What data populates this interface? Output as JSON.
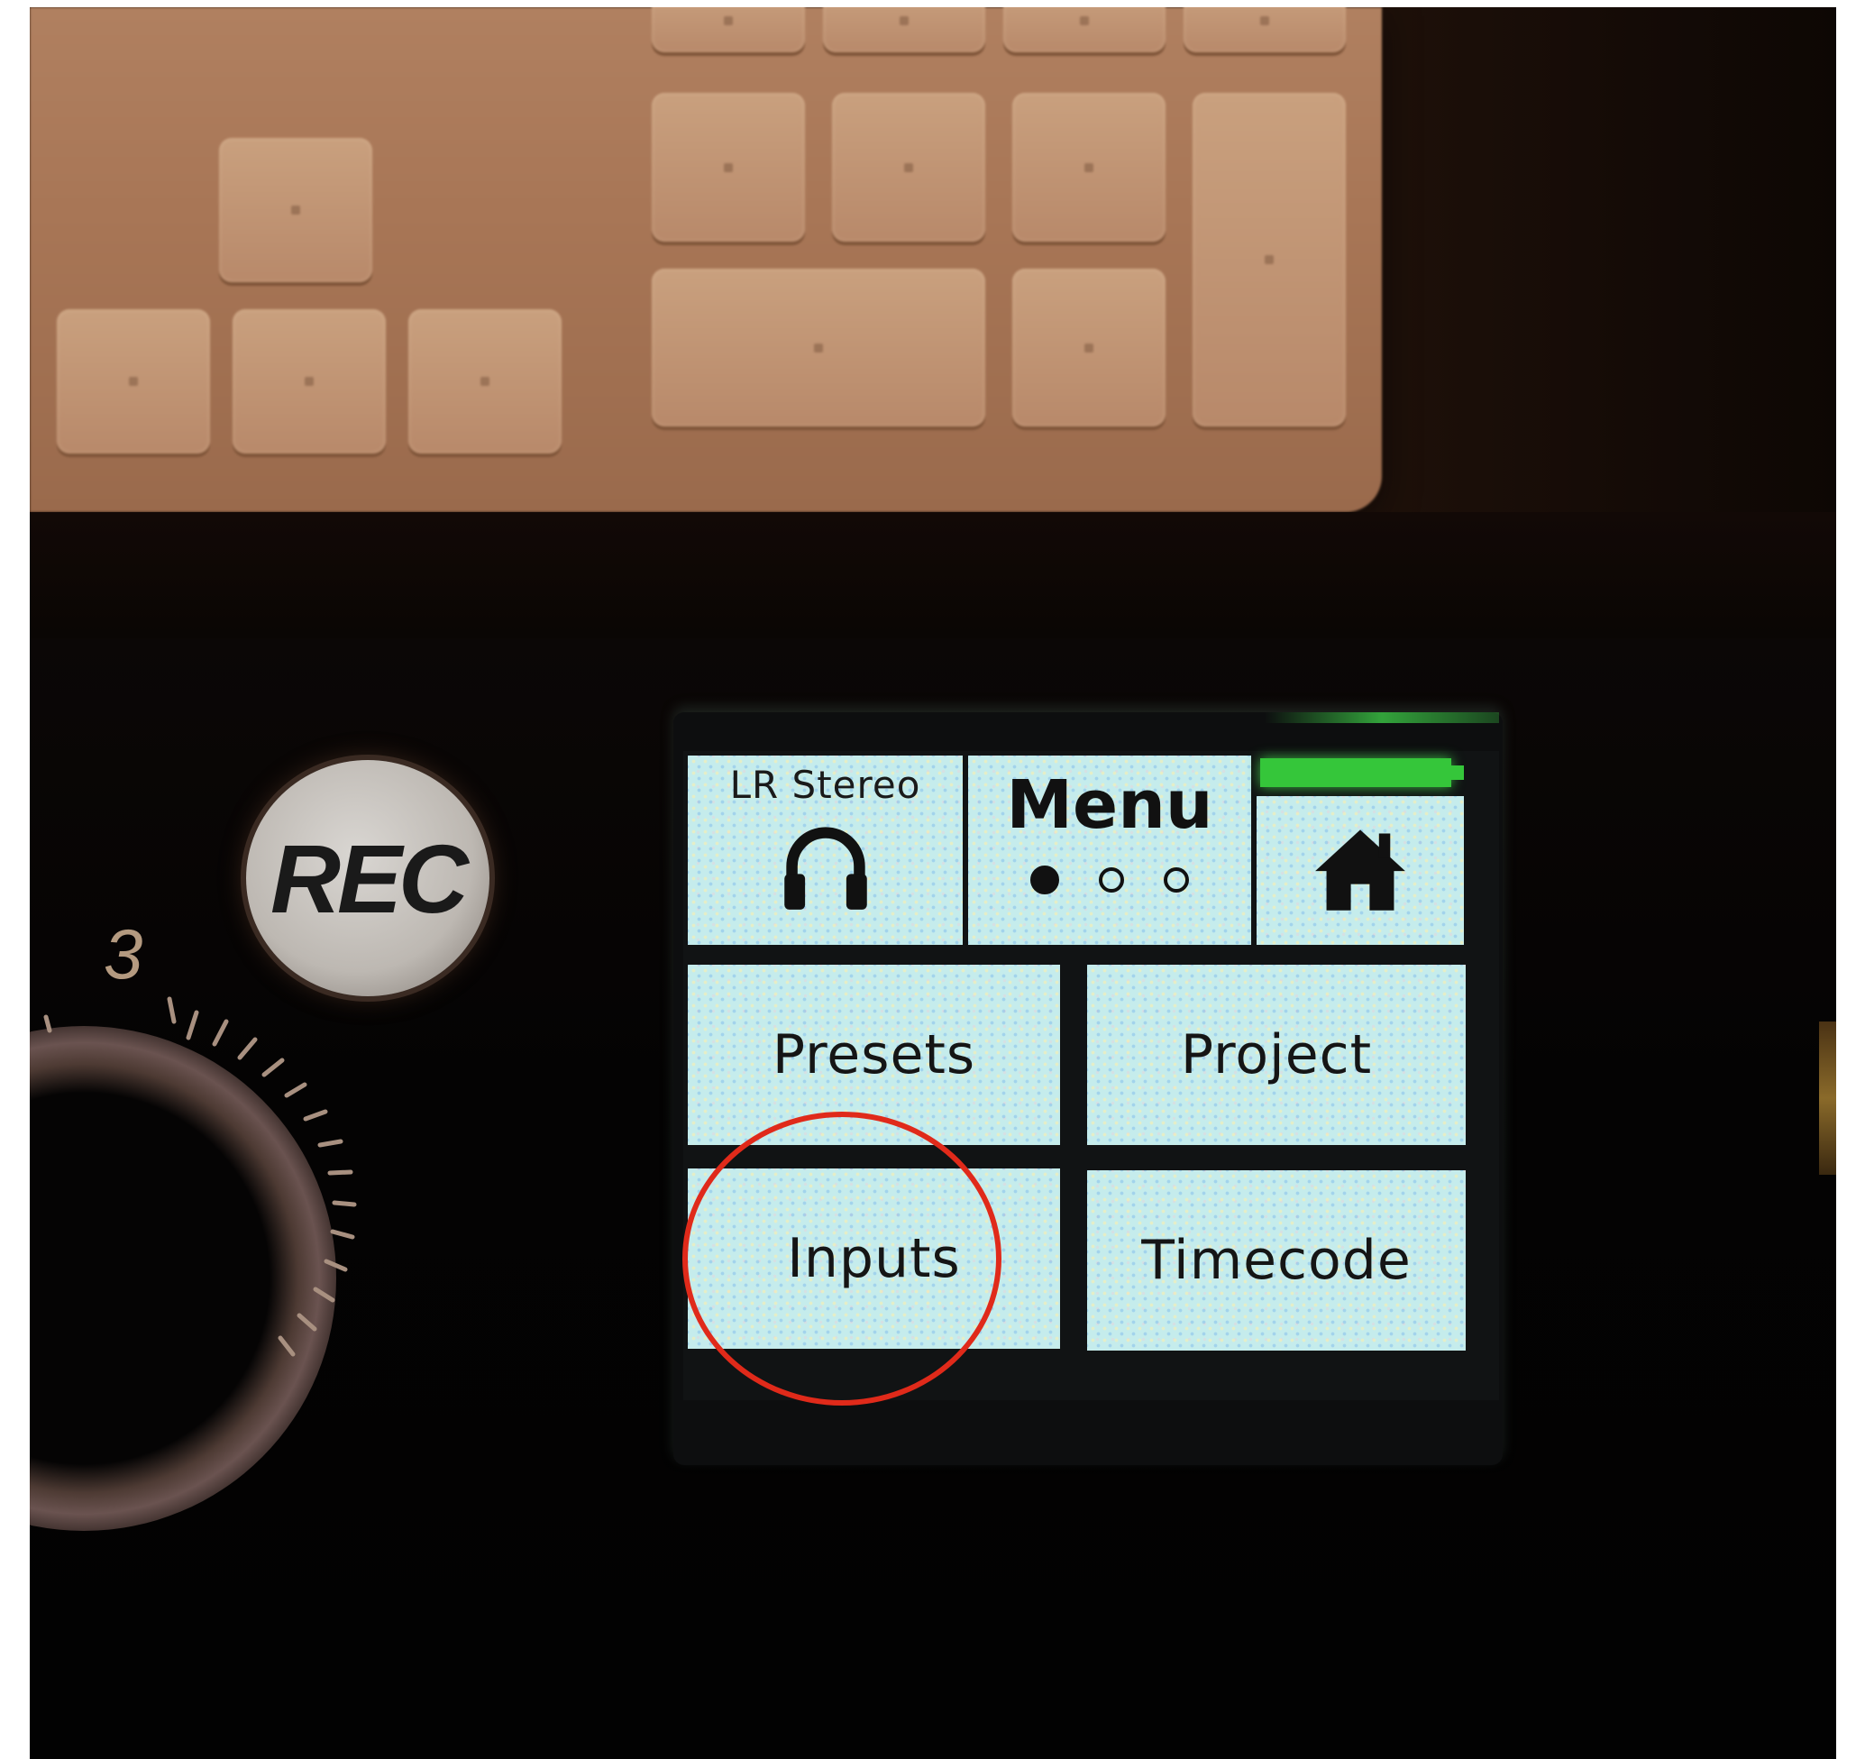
{
  "device": {
    "rec_button_label": "REC",
    "dial_number": "3"
  },
  "screen": {
    "header": {
      "monitor_label": "LR Stereo",
      "monitor_icon": "headphones-icon",
      "title": "Menu",
      "page_indicator": {
        "current_page": 1,
        "total_pages": 3
      },
      "home_icon": "home-icon",
      "battery_level": 1.0
    },
    "buttons": [
      {
        "label": "Presets"
      },
      {
        "label": "Project"
      },
      {
        "label": "Inputs"
      },
      {
        "label": "Timecode"
      }
    ]
  },
  "colors": {
    "tile_background": "#c5ecec",
    "battery": "#35c63a",
    "highlight": "#e02a1a"
  }
}
